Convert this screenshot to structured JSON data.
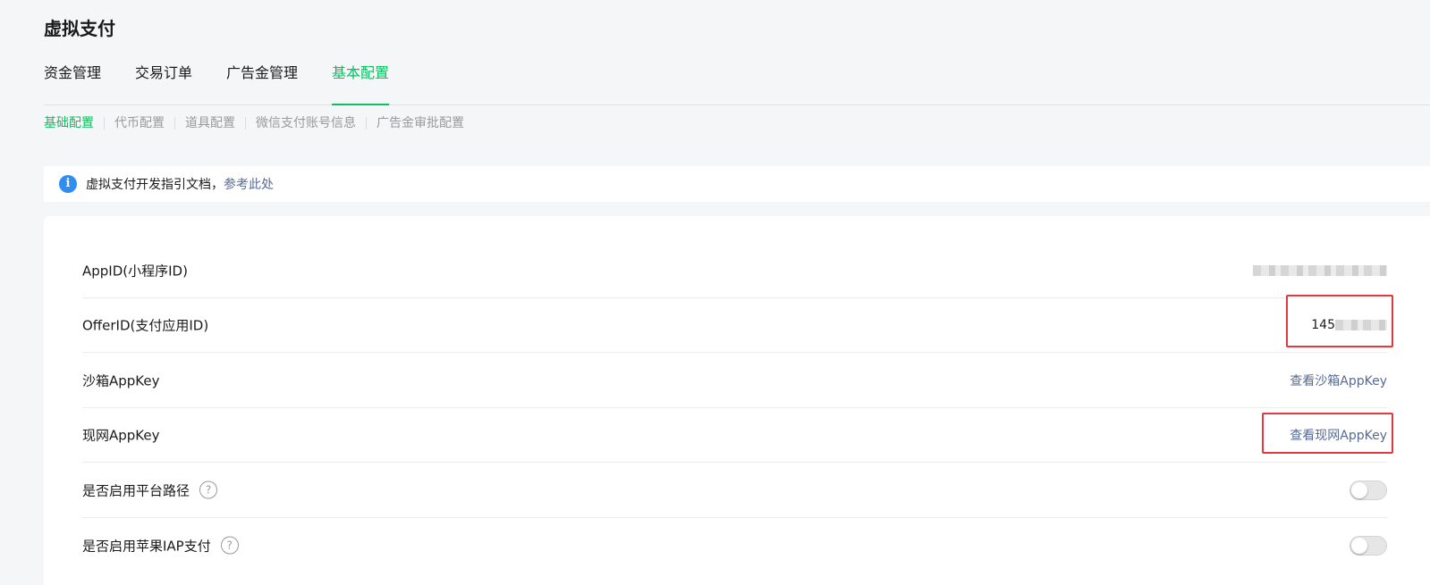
{
  "page_title": "虚拟支付",
  "tabs": [
    {
      "label": "资金管理",
      "active": false
    },
    {
      "label": "交易订单",
      "active": false
    },
    {
      "label": "广告金管理",
      "active": false
    },
    {
      "label": "基本配置",
      "active": true
    }
  ],
  "subtabs": [
    {
      "label": "基础配置",
      "active": true
    },
    {
      "label": "代币配置",
      "active": false
    },
    {
      "label": "道具配置",
      "active": false
    },
    {
      "label": "微信支付账号信息",
      "active": false
    },
    {
      "label": "广告金审批配置",
      "active": false
    }
  ],
  "notice": {
    "text": "虚拟支付开发指引文档，",
    "link_label": "参考此处",
    "icon": "info-icon"
  },
  "settings": {
    "appid": {
      "label": "AppID(小程序ID)",
      "value": ""
    },
    "offerid": {
      "label": "OfferID(支付应用ID)",
      "value": "145"
    },
    "sandbox_appkey": {
      "label": "沙箱AppKey",
      "action": "查看沙箱AppKey"
    },
    "live_appkey": {
      "label": "现网AppKey",
      "action": "查看现网AppKey"
    },
    "platform_path": {
      "label": "是否启用平台路径",
      "enabled": false
    },
    "apple_iap": {
      "label": "是否启用苹果IAP支付",
      "enabled": false
    }
  },
  "colors": {
    "accent": "#07c160",
    "link": "#576b95",
    "highlight": "#e0393e",
    "info": "#2f8ff0"
  }
}
